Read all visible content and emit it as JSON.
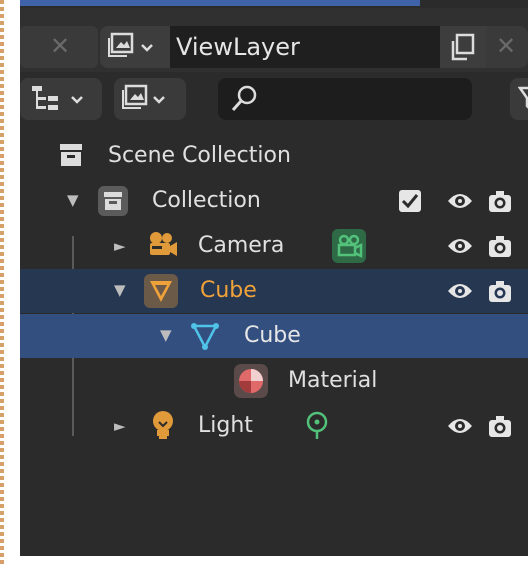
{
  "header": {
    "view_layer_name": "ViewLayer"
  },
  "toolbar": {
    "search_placeholder": ""
  },
  "outliner": {
    "scene_collection": "Scene Collection",
    "collection": "Collection",
    "camera": "Camera",
    "cube_object": "Cube",
    "cube_mesh": "Cube",
    "material": "Material",
    "light": "Light"
  },
  "colors": {
    "active_row": "#334a73",
    "selected_row": "#334f80",
    "active_text": "#f0a23a",
    "camera_icon": "#e09a3a",
    "mesh_icon": "#4fc3e8",
    "data_icon_green": "#52c27a"
  }
}
